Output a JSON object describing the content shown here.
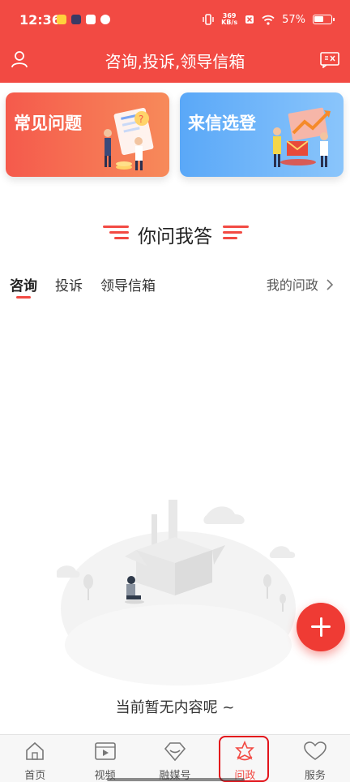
{
  "status_bar": {
    "time": "12:36",
    "speed_value": "369",
    "speed_unit": "KB/s",
    "battery": "57%"
  },
  "header": {
    "title": "咨询,投诉,领导信箱",
    "left_icon": "user-icon",
    "right_icon": "mail-icon"
  },
  "banners": [
    {
      "label": "常见问题",
      "color": "#f55a4c"
    },
    {
      "label": "来信选登",
      "color": "#5aa8f8"
    }
  ],
  "section": {
    "title": "你问我答"
  },
  "tabs": [
    {
      "label": "咨询",
      "active": true
    },
    {
      "label": "投诉",
      "active": false
    },
    {
      "label": "领导信箱",
      "active": false
    }
  ],
  "my_link": {
    "label": "我的问政",
    "icon": "chevron-right-icon"
  },
  "empty_state": {
    "text": "当前暂无内容呢 ~"
  },
  "fab": {
    "icon": "plus-icon"
  },
  "nav": [
    {
      "label": "首页",
      "icon": "home-icon",
      "active": false
    },
    {
      "label": "视频",
      "icon": "video-icon",
      "active": false
    },
    {
      "label": "融媒号",
      "icon": "media-icon",
      "active": false
    },
    {
      "label": "问政",
      "icon": "star-bag-icon",
      "active": true
    },
    {
      "label": "服务",
      "icon": "heart-icon",
      "active": false
    }
  ],
  "colors": {
    "accent": "#f24a43",
    "fab": "#ef3b34"
  }
}
